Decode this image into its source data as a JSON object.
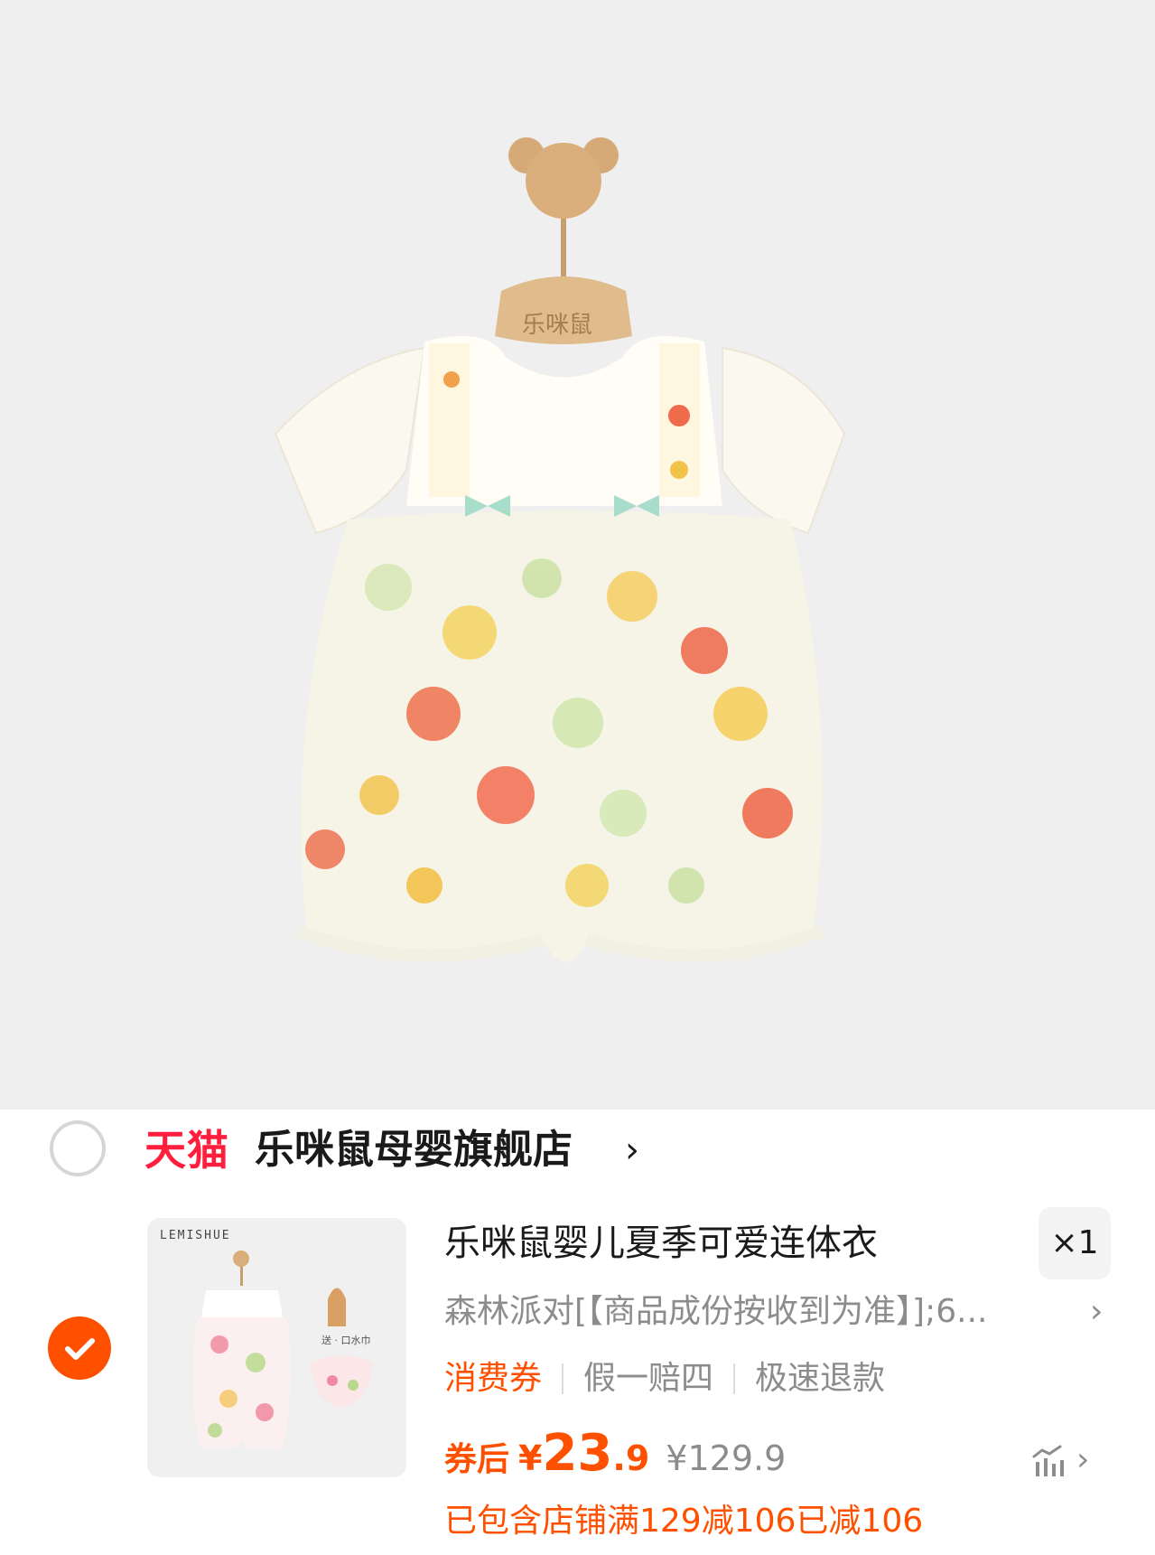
{
  "product_image": {
    "hanger_brand": "乐咪鼠"
  },
  "shop": {
    "platform": "天猫",
    "name": "乐咪鼠母婴旗舰店",
    "chevron": "›",
    "selected": false
  },
  "item": {
    "selected": true,
    "thumbnail": {
      "brand": "LEMISHUE",
      "gift_label": "送 · 口水巾"
    },
    "title": "乐咪鼠婴儿夏季可爱连体衣",
    "quantity": "×1",
    "sku": "森林派对[【商品成份按收到为准】];6...",
    "sku_chevron": "›",
    "tags": [
      {
        "label": "消费券",
        "color": "#ff5000"
      },
      {
        "label": "假一赔四",
        "color": "#8c8c8c"
      },
      {
        "label": "极速退款",
        "color": "#8c8c8c"
      }
    ],
    "price": {
      "coupon_label": "券后",
      "currency": "¥",
      "integer": "23",
      "decimal": ".9",
      "original": "¥129.9"
    },
    "trend_chevron": "›",
    "promo": "已包含店铺满129减106已减106"
  },
  "colors": {
    "accent": "#ff5000",
    "tmall_red": "#ff1f3d",
    "hero_bg": "#efefef"
  },
  "icons": {
    "check": "check-icon",
    "trend": "price-trend-icon"
  }
}
